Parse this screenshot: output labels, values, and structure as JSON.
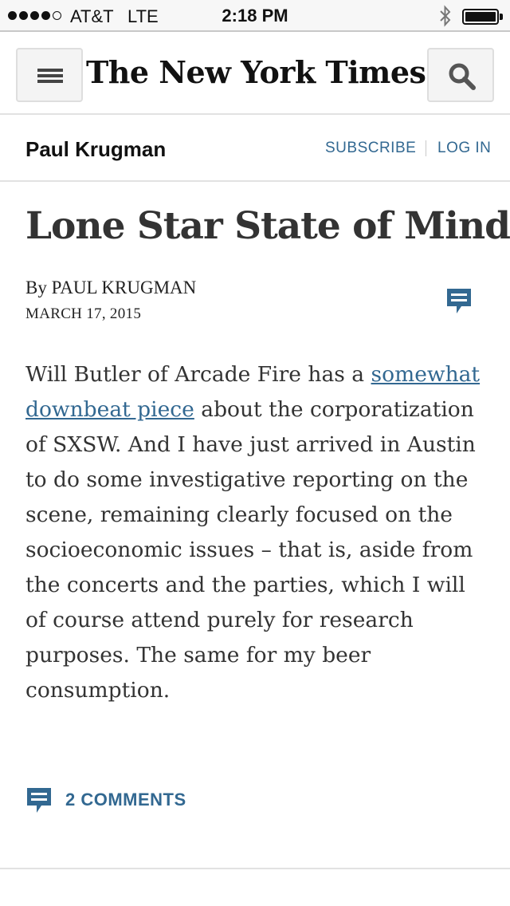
{
  "status_bar": {
    "carrier": "AT&T",
    "network": "LTE",
    "time": "2:18 PM",
    "signal_bars_filled": 4,
    "signal_bars_total": 5,
    "battery_level": 1.0
  },
  "masthead": {
    "logo_text": "The New York Times",
    "menu_icon": "hamburger-menu-icon",
    "search_icon": "search-icon"
  },
  "section": {
    "title": "Paul Krugman",
    "subscribe_label": "SUBSCRIBE",
    "login_label": "LOG IN"
  },
  "article": {
    "headline": "Lone Star State of Mind",
    "byline": "By PAUL KRUGMAN",
    "date": "MARCH 17, 2015",
    "body_before_link": "Will Butler of Arcade Fire has a ",
    "body_link": "somewhat downbeat piece",
    "body_after_link": " about the corporatization of SXSW. And I have just arrived in Austin to do some investigative reporting on the scene, remaining clearly focused on the socioeconomic issues – that is, aside from the concerts and the parties, which I will of course attend purely for research purposes. The same for my beer consumption.",
    "comments_label": "2 COMMENTS",
    "comment_icon": "comment-icon"
  },
  "colors": {
    "link": "#326891",
    "text": "#333333",
    "status_bar_bg": "#f7f7f7"
  }
}
